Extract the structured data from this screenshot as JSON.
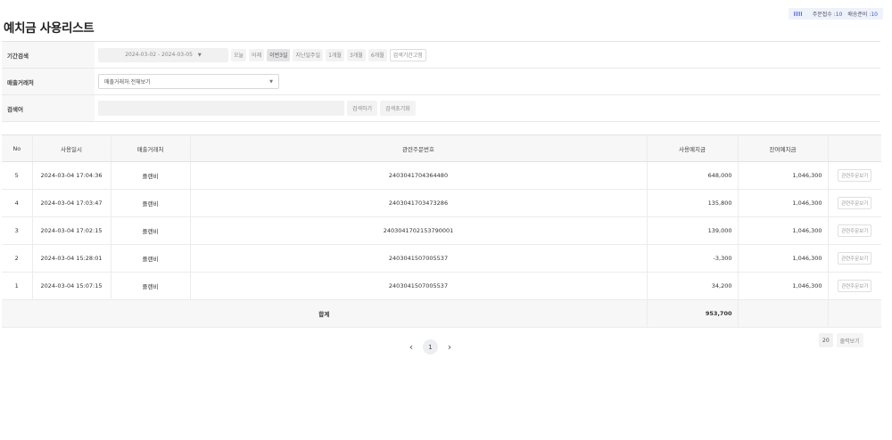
{
  "page": {
    "title": "예치금 사용리스트"
  },
  "top_status": {
    "label1": "주문접수 :",
    "value1": "10",
    "label2": "배송준비 :",
    "value2": "10"
  },
  "filters": {
    "period_label": "기간검색",
    "date_range": "2024-03-02 - 2024-03-05",
    "quick_ranges": [
      "오늘",
      "어제",
      "이번3일",
      "지난일주일",
      "1개월",
      "3개월",
      "6개월"
    ],
    "fix_period_label": "검색기간고정",
    "vendor_label": "매출거래처",
    "vendor_selected": "매출거래처:전체보기",
    "keyword_label": "검색어",
    "keyword_value": "",
    "search_button": "검색하기",
    "reset_button": "검색초기화"
  },
  "table": {
    "columns": [
      "No",
      "사용일시",
      "매출거래처",
      "관련주문번호",
      "사용예치금",
      "잔여예치금",
      ""
    ],
    "rows": [
      {
        "no": "5",
        "datetime": "2024-03-04 17:04:36",
        "vendor": "플랜비",
        "order_no": "2403041704364480",
        "used": "648,000",
        "balance": "1,046,300",
        "action": "관련주문보기"
      },
      {
        "no": "4",
        "datetime": "2024-03-04 17:03:47",
        "vendor": "플랜비",
        "order_no": "2403041703473286",
        "used": "135,800",
        "balance": "1,046,300",
        "action": "관련주문보기"
      },
      {
        "no": "3",
        "datetime": "2024-03-04 17:02:15",
        "vendor": "플랜비",
        "order_no": "2403041702153790001",
        "used": "139,000",
        "balance": "1,046,300",
        "action": "관련주문보기"
      },
      {
        "no": "2",
        "datetime": "2024-03-04 15:28:01",
        "vendor": "플랜비",
        "order_no": "2403041507005537",
        "used": "-3,300",
        "balance": "1,046,300",
        "action": "관련주문보기"
      },
      {
        "no": "1",
        "datetime": "2024-03-04 15:07:15",
        "vendor": "플랜비",
        "order_no": "2403041507005537",
        "used": "34,200",
        "balance": "1,046,300",
        "action": "관련주문보기"
      }
    ],
    "total_label": "합계",
    "total_used": "953,700"
  },
  "pagination": {
    "prev": "‹",
    "current": "1",
    "next": "›"
  },
  "page_size": {
    "value": "20",
    "button": "줄력보기"
  },
  "colors": {
    "accent": "#3a5bd0",
    "header_bg": "#f7f7f8",
    "border": "#e2e2e2"
  }
}
